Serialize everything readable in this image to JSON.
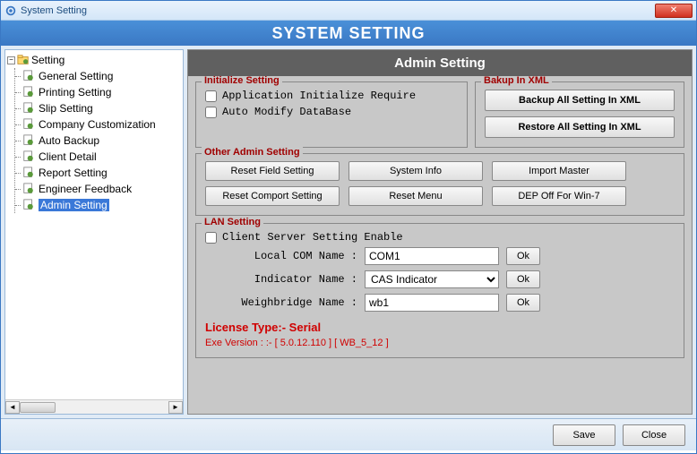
{
  "window": {
    "title": "System Setting",
    "close": "✕"
  },
  "banner": "SYSTEM SETTING",
  "tree": {
    "root": "Setting",
    "toggle": "−",
    "items": [
      "General Setting",
      "Printing Setting",
      "Slip Setting",
      "Company Customization",
      "Auto Backup",
      "Client Detail",
      "Report Setting",
      "Engineer Feedback",
      "Admin Setting"
    ],
    "selected_index": 8
  },
  "panel": {
    "title": "Admin Setting",
    "initialize": {
      "legend": "Initialize Setting",
      "app_init": "Application Initialize Require",
      "auto_modify": "Auto Modify DataBase"
    },
    "backup": {
      "legend": "Bakup In XML",
      "backup_btn": "Backup All Setting In XML",
      "restore_btn": "Restore All Setting In XML"
    },
    "other": {
      "legend": "Other Admin Setting",
      "reset_field": "Reset Field Setting",
      "system_info": "System Info",
      "import_master": "Import Master",
      "reset_comport": "Reset Comport Setting",
      "reset_menu": "Reset Menu",
      "dep_off": "DEP Off For Win-7"
    },
    "lan": {
      "legend": "LAN Setting",
      "client_server": "Client Server Setting Enable",
      "local_com_label": "Local COM Name :",
      "local_com_value": "COM1",
      "indicator_label": "Indicator Name :",
      "indicator_value": "CAS Indicator",
      "weighbridge_label": "Weighbridge Name :",
      "weighbridge_value": "wb1",
      "ok": "Ok"
    },
    "license": "License Type:- Serial",
    "exe_version": "Exe Version : :-  [ 5.0.12.110 ] [ WB_5_12 ]"
  },
  "footer": {
    "save": "Save",
    "close": "Close"
  }
}
